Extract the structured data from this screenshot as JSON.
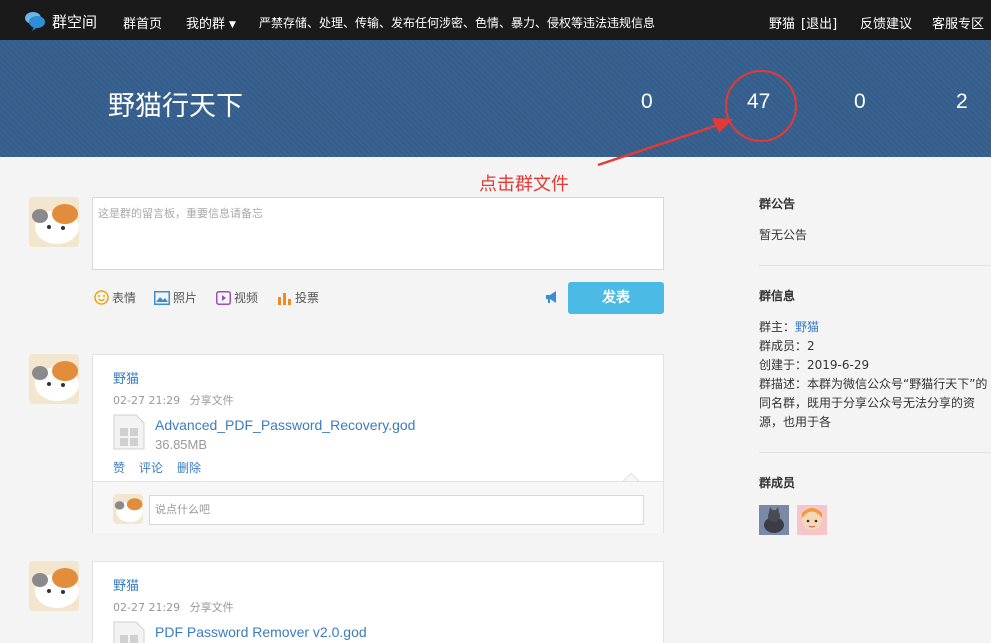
{
  "nav": {
    "logo_text": "群空间",
    "home": "群首页",
    "my_groups": "我的群",
    "notice": "严禁存储、处理、传输、发布任何涉密、色情、暴力、侵权等违法违规信息",
    "user": "野猫",
    "logout": "[退出]",
    "feedback": "反馈建议",
    "support": "客服专区"
  },
  "banner": {
    "group_name": "野猫行天下",
    "stats": [
      "0",
      "47",
      "0",
      "2"
    ]
  },
  "annotation": {
    "text": "点击群文件",
    "color": "#e53935"
  },
  "composer": {
    "placeholder": "这是群的留言板，重要信息请备忘",
    "tools": [
      {
        "label": "表情",
        "icon": "smiley-icon"
      },
      {
        "label": "照片",
        "icon": "photo-icon"
      },
      {
        "label": "视频",
        "icon": "video-icon"
      },
      {
        "label": "投票",
        "icon": "poll-icon"
      }
    ],
    "submit": "发表"
  },
  "posts": [
    {
      "author": "野猫",
      "time": "02-27 21:29",
      "action_text": "分享文件",
      "file_name": "Advanced_PDF_Password_Recovery.god",
      "file_size": "36.85MB",
      "actions": [
        "赞",
        "评论",
        "删除"
      ],
      "comment_placeholder": "说点什么吧"
    },
    {
      "author": "野猫",
      "time": "02-27 21:29",
      "action_text": "分享文件",
      "file_name": "PDF Password Remover v2.0.god"
    }
  ],
  "sidebar": {
    "announcement_title": "群公告",
    "announcement_text": "暂无公告",
    "info_title": "群信息",
    "owner_label": "群主：",
    "owner_name": "野猫",
    "members_label": "群成员：2",
    "created_label": "创建于：2019-6-29",
    "desc_line1": "群描述：本群为微信公众号“野猫行天下”的",
    "desc_line2": "同名群，既用于分享公众号无法分享的资",
    "desc_line3": "源，也用于各",
    "members_title": "群成员"
  },
  "colors": {
    "banner": "#355f8e",
    "accent": "#4bbbe6",
    "link": "#3a7cc0"
  }
}
